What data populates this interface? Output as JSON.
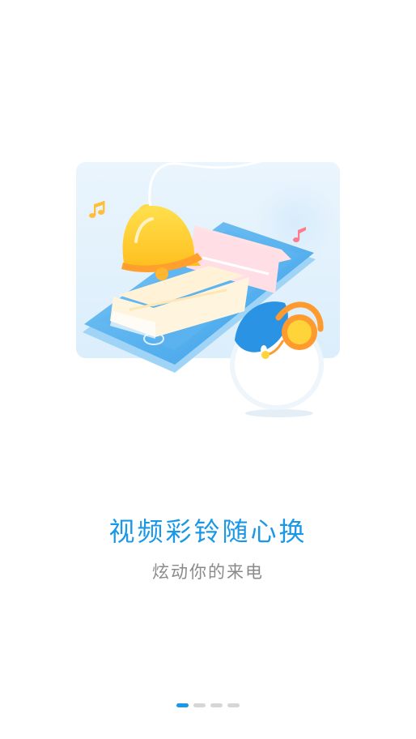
{
  "onboarding": {
    "title": "视频彩铃随心换",
    "subtitle": "炫动你的来电",
    "pages": 4,
    "active_page": 0
  },
  "colors": {
    "accent": "#1a97e6",
    "subtitle_text": "#8a8a8a",
    "dot_inactive": "#d6d6d6"
  },
  "illustration": {
    "icon": "phone-bell-mascot-illustration"
  }
}
